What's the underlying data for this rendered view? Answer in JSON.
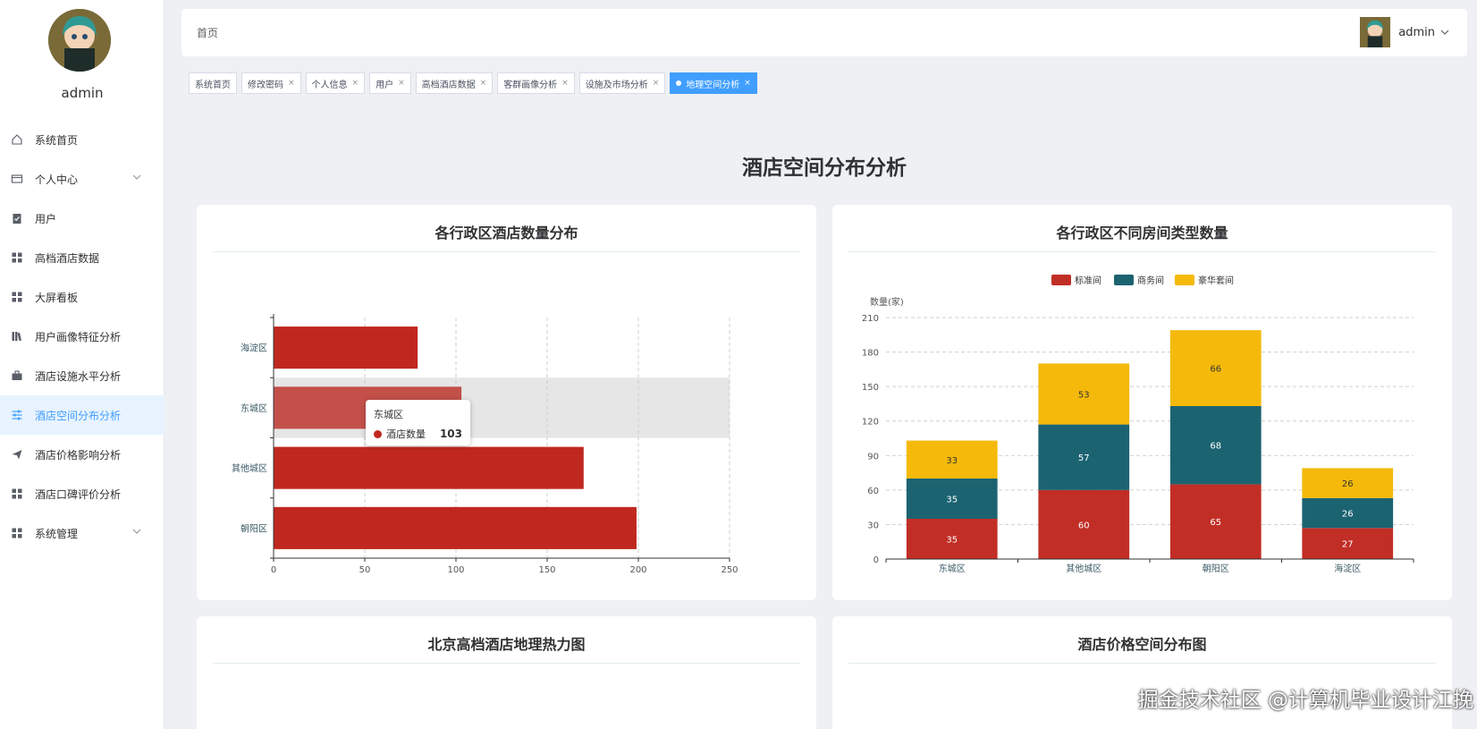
{
  "sidebar": {
    "username": "admin",
    "items": [
      {
        "label": "系统首页",
        "icon": "home-icon"
      },
      {
        "label": "个人中心",
        "icon": "card-icon",
        "has_children": true
      },
      {
        "label": "用户",
        "icon": "clipboard-icon"
      },
      {
        "label": "高档酒店数据",
        "icon": "grid-icon"
      },
      {
        "label": "大屏看板",
        "icon": "grid-icon"
      },
      {
        "label": "用户画像特征分析",
        "icon": "library-icon"
      },
      {
        "label": "酒店设施水平分析",
        "icon": "briefcase-icon"
      },
      {
        "label": "酒店空间分布分析",
        "icon": "sliders-icon",
        "active": true
      },
      {
        "label": "酒店价格影响分析",
        "icon": "send-icon"
      },
      {
        "label": "酒店口碑评价分析",
        "icon": "grid-icon"
      },
      {
        "label": "系统管理",
        "icon": "grid-icon",
        "has_children": true
      }
    ]
  },
  "header": {
    "breadcrumb": "首页",
    "username": "admin"
  },
  "tags": [
    {
      "label": "系统首页",
      "closable": false
    },
    {
      "label": "修改密码",
      "closable": true
    },
    {
      "label": "个人信息",
      "closable": true
    },
    {
      "label": "用户",
      "closable": true
    },
    {
      "label": "高档酒店数据",
      "closable": true
    },
    {
      "label": "客群画像分析",
      "closable": true
    },
    {
      "label": "设施及市场分析",
      "closable": true
    },
    {
      "label": "地理空间分析",
      "closable": true,
      "active": true
    }
  ],
  "close_glyph": "×",
  "page_title": "酒店空间分布分析",
  "cards": {
    "card1_title": "各行政区酒店数量分布",
    "card2_title": "各行政区不同房间类型数量",
    "card3_title": "北京高档酒店地理热力图",
    "card4_title": "酒店价格空间分布图"
  },
  "tooltip": {
    "title": "东城区",
    "series": "酒店数量",
    "value": "103"
  },
  "chart_data": [
    {
      "type": "bar",
      "orientation": "horizontal",
      "title": "各行政区酒店数量分布",
      "categories": [
        "海淀区",
        "东城区",
        "其他城区",
        "朝阳区"
      ],
      "values": [
        79,
        103,
        170,
        199
      ],
      "xlim": [
        0,
        250
      ],
      "xticks": [
        0,
        50,
        100,
        150,
        200,
        250
      ],
      "color": "#c0281f",
      "highlight_category": "东城区",
      "grid": true
    },
    {
      "type": "bar",
      "stacked": true,
      "title": "各行政区不同房间类型数量",
      "ylabel": "数量(家)",
      "categories": [
        "东城区",
        "其他城区",
        "朝阳区",
        "海淀区"
      ],
      "series": [
        {
          "name": "标准间",
          "values": [
            35,
            60,
            65,
            27
          ],
          "color": "#c12e26"
        },
        {
          "name": "商务间",
          "values": [
            35,
            57,
            68,
            26
          ],
          "color": "#1c6371"
        },
        {
          "name": "豪华套间",
          "values": [
            33,
            53,
            66,
            26
          ],
          "color": "#f4b90a"
        }
      ],
      "ylim": [
        0,
        210
      ],
      "yticks": [
        0,
        30,
        60,
        90,
        120,
        150,
        180,
        210
      ],
      "legend": "top-center",
      "grid": true
    }
  ],
  "watermark": "掘金技术社区 @计算机毕业设计江挽"
}
